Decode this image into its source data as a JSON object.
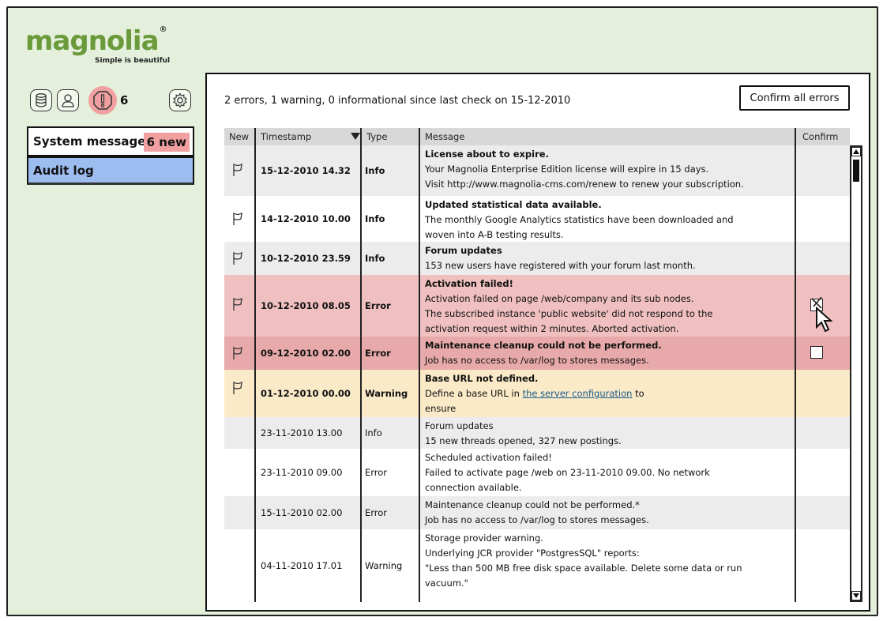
{
  "logo": {
    "name": "magnolia",
    "mark": "®",
    "tagline": "Simple is beautiful"
  },
  "toolbar": {
    "alert_count": "6"
  },
  "sidebar": {
    "items": [
      {
        "label": "System messages",
        "badge": "6 new"
      },
      {
        "label": "Audit log"
      }
    ]
  },
  "summary": "2 errors, 1 warning, 0 informational since last check on 15-12-2010",
  "confirm_all_label": "Confirm all errors",
  "table": {
    "columns": [
      "New",
      "Timestamp",
      "Type",
      "Message",
      "Confirm"
    ],
    "rows": [
      {
        "flag": true,
        "timestamp": "15-12-2010 14.32",
        "type": "Info",
        "lines": [
          "License about to expire.",
          "Your Magnolia Enterprise Edition license will expire in 15 days.",
          "Visit http://www.magnolia-cms.com/renew to renew your subscription."
        ]
      },
      {
        "flag": true,
        "timestamp": "14-12-2010 10.00",
        "type": "Info",
        "lines": [
          "Updated statistical data available.",
          "The monthly Google Analytics statistics have been downloaded and",
          "woven into A-B testing results."
        ]
      },
      {
        "flag": true,
        "timestamp": "10-12-2010 23.59",
        "type": "Info",
        "lines": [
          "Forum updates",
          "153 new users have registered with your forum last month."
        ]
      },
      {
        "flag": true,
        "timestamp": "10-12-2010 08.05",
        "type": "Error",
        "lines": [
          "Activation failed!",
          "Activation failed on page /web/company and its sub nodes.",
          "The subscribed instance 'public website' did not respond to the",
          "activation request within 2 minutes. Aborted activation."
        ]
      },
      {
        "flag": true,
        "timestamp": "09-12-2010 02.00",
        "type": "Error",
        "lines": [
          "Maintenance cleanup could not be performed.",
          "Job has no access to /var/log to stores messages."
        ]
      },
      {
        "flag": true,
        "timestamp": "01-12-2010 00.00",
        "type": "Warning",
        "lines": [
          "Base URL not defined.",
          "Define a base URL in",
          "ensure"
        ],
        "link": "the server configuration",
        "link_after": "to"
      },
      {
        "flag": false,
        "timestamp": "23-11-2010 13.00",
        "type": "Info",
        "lines": [
          "Forum updates",
          "15 new threads opened, 327 new postings."
        ]
      },
      {
        "flag": false,
        "timestamp": "23-11-2010 09.00",
        "type": "Error",
        "lines": [
          "Scheduled activation failed!",
          "Failed to activate page /web on 23-11-2010 09.00. No network",
          "connection available."
        ]
      },
      {
        "flag": false,
        "timestamp": "15-11-2010 02.00",
        "type": "Error",
        "lines": [
          "Maintenance cleanup could not be performed.*",
          "Job has no access to /var/log to stores messages."
        ]
      },
      {
        "flag": false,
        "timestamp": "04-11-2010 17.01",
        "type": "Warning",
        "lines": [
          "Storage provider warning.",
          "Underlying JCR provider \"PostgresSQL\" reports:",
          "\"Less than 500 MB free disk space available. Delete some data or run",
          "vacuum.\""
        ]
      }
    ]
  },
  "colors": {
    "app_bg": "#e4efdc",
    "error_row": "#f0c0c0",
    "warning_row": "#faeac8",
    "selected_nav": "#9dbcf0",
    "alert": "#f0a0a0",
    "logo_green": "#6a9a3a"
  }
}
